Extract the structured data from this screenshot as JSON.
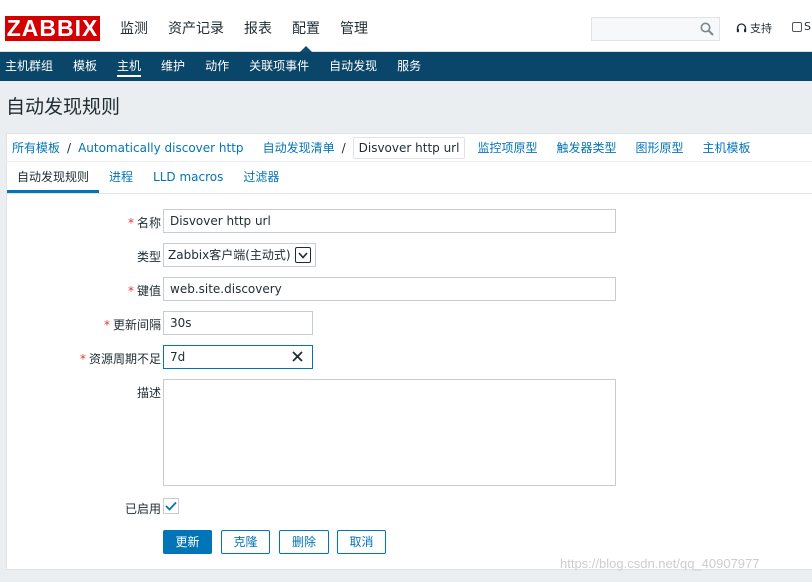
{
  "logo": {
    "text": "ZABBIX"
  },
  "top_nav": [
    "监测",
    "资产记录",
    "报表",
    "配置",
    "管理"
  ],
  "top_nav_active": "配置",
  "search": {
    "value": "",
    "placeholder": ""
  },
  "support_label": "支持",
  "share_label": "S",
  "sub_nav": [
    "主机群组",
    "模板",
    "主机",
    "维护",
    "动作",
    "关联项事件",
    "自动发现",
    "服务"
  ],
  "sub_nav_active": "主机",
  "page_title": "自动发现规则",
  "breadcrumb": {
    "all_templates": "所有模板",
    "template": "Automatically discover http",
    "discovery_list": "自动发现清单",
    "current": "Disvover http url",
    "links": [
      "监控项原型",
      "触发器类型",
      "图形原型",
      "主机模板"
    ]
  },
  "tabs": [
    "自动发现规则",
    "进程",
    "LLD macros",
    "过滤器"
  ],
  "tabs_active": "自动发现规则",
  "form": {
    "name_label": "名称",
    "name_value": "Disvover http url",
    "type_label": "类型",
    "type_value": "Zabbix客户端(主动式)",
    "key_label": "键值",
    "key_value": "web.site.discovery",
    "interval_label": "更新间隔",
    "interval_value": "30s",
    "lifetime_label": "资源周期不足",
    "lifetime_value": "7d",
    "description_label": "描述",
    "description_value": "",
    "enabled_label": "已启用",
    "enabled": true,
    "required_mark": "*"
  },
  "buttons": {
    "update": "更新",
    "clone": "克隆",
    "delete": "删除",
    "cancel": "取消"
  },
  "watermark": "https://blog.csdn.net/qq_40907977",
  "colors": {
    "brand_red": "#d40000",
    "nav_blue": "#0a466a",
    "link_blue": "#0275b8",
    "required_red": "#e33734"
  }
}
